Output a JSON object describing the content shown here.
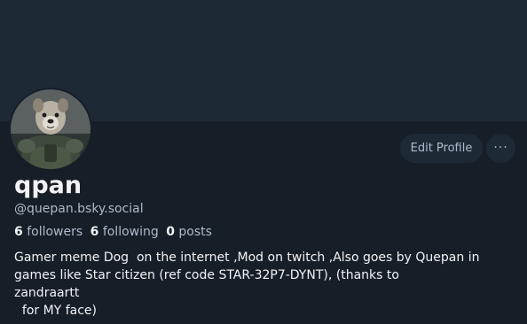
{
  "profile": {
    "display_name": "qpan",
    "handle": "@quepan.bsky.social",
    "bio": "Gamer meme Dog  on the internet ,Mod on twitch ,Also goes by Quepan in\ngames like Star citizen (ref code STAR-32P7-DYNT), (thanks to\nzandraartt\n  for MY face)"
  },
  "stats": {
    "followers_count": "6",
    "followers_label": "followers",
    "following_count": "6",
    "following_label": "following",
    "posts_count": "0",
    "posts_label": "posts"
  },
  "actions": {
    "edit_profile_label": "Edit Profile",
    "more_label": "···"
  },
  "colors": {
    "background": "#161e27",
    "banner": "#1e2936",
    "button_bg": "#1e2936",
    "muted_text": "#aebbc9",
    "primary_text": "#f1f3f5"
  },
  "icons": {
    "avatar": "dog-in-armor-avatar",
    "more": "ellipsis-icon"
  }
}
